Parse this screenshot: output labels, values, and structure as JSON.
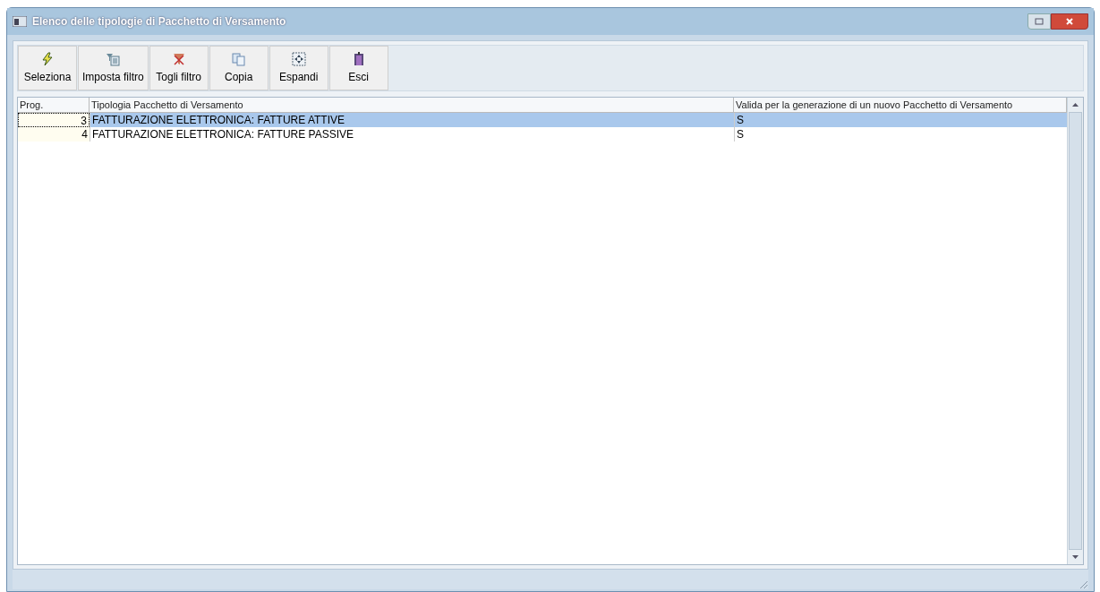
{
  "window": {
    "title": "Elenco delle tipologie di Pacchetto di Versamento"
  },
  "toolbar": [
    {
      "kind": "select",
      "label": "Seleziona"
    },
    {
      "kind": "filter",
      "label": "Imposta filtro"
    },
    {
      "kind": "unfilter",
      "label": "Togli filtro"
    },
    {
      "kind": "copy",
      "label": "Copia"
    },
    {
      "kind": "expand",
      "label": "Espandi"
    },
    {
      "kind": "exit",
      "label": "Esci"
    }
  ],
  "table": {
    "columns": [
      "Prog.",
      "Tipologia Pacchetto di Versamento",
      "Valida per la generazione di un nuovo Pacchetto di Versamento"
    ],
    "rows": [
      {
        "cells": [
          "3",
          "FATTURAZIONE ELETTRONICA: FATTURE ATTIVE",
          "S"
        ],
        "selected": true
      },
      {
        "cells": [
          "4",
          "FATTURAZIONE ELETTRONICA: FATTURE PASSIVE",
          "S"
        ],
        "selected": false
      }
    ]
  }
}
